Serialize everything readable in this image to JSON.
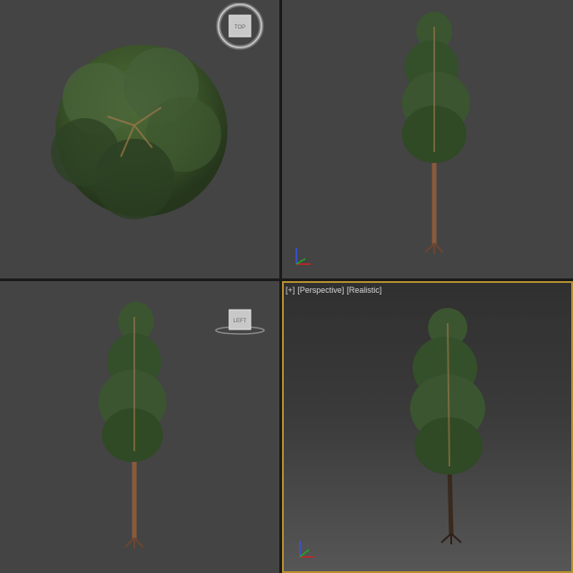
{
  "viewports": {
    "top": {
      "cube_label": "TOP"
    },
    "front": {},
    "left": {
      "cube_label": "LEFT"
    },
    "perspective": {
      "label_plus": "[+]",
      "label_view": "[Perspective]",
      "label_shading": "[Realistic]"
    }
  },
  "icons": {
    "nav_cube": "view-cube-icon",
    "axis": "axis-tripod-icon",
    "tree": "pine-tree-model"
  },
  "colors": {
    "viewport_bg": "#444444",
    "active_border": "#b7912e",
    "foliage_dark": "#2f4a24",
    "foliage_light": "#4d6b35",
    "trunk": "#8a5a3a",
    "axis_x": "#cc2222",
    "axis_y": "#22aa22",
    "axis_z": "#3355ee"
  }
}
